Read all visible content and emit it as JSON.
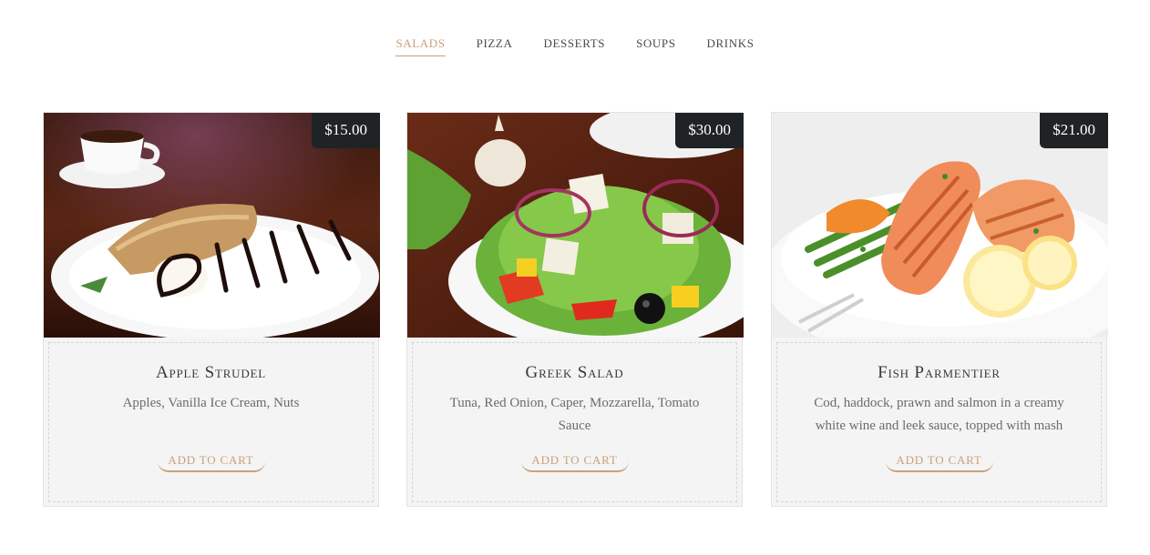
{
  "tabs": [
    {
      "label": "SALADS",
      "active": true
    },
    {
      "label": "PIZZA",
      "active": false
    },
    {
      "label": "DESSERTS",
      "active": false
    },
    {
      "label": "SOUPS",
      "active": false
    },
    {
      "label": "DRINKS",
      "active": false
    }
  ],
  "products": [
    {
      "name": "Apple Strudel",
      "price": "$15.00",
      "description": "Apples, Vanilla Ice Cream, Nuts",
      "button_label": "ADD TO CART",
      "image": "apple-strudel-photo"
    },
    {
      "name": "Greek Salad",
      "price": "$30.00",
      "description": "Tuna, Red Onion, Caper, Mozzarella, Tomato Sauce",
      "button_label": "ADD TO CART",
      "image": "greek-salad-photo"
    },
    {
      "name": "Fish Parmentier",
      "price": "$21.00",
      "description": "Cod, haddock, prawn and salmon in a creamy white wine and leek sauce, topped with mash",
      "button_label": "ADD TO CART",
      "image": "fish-parmentier-photo"
    }
  ],
  "colors": {
    "accent": "#c9a07a",
    "price_bg": "#1f2326",
    "card_bg": "#f4f4f4"
  }
}
